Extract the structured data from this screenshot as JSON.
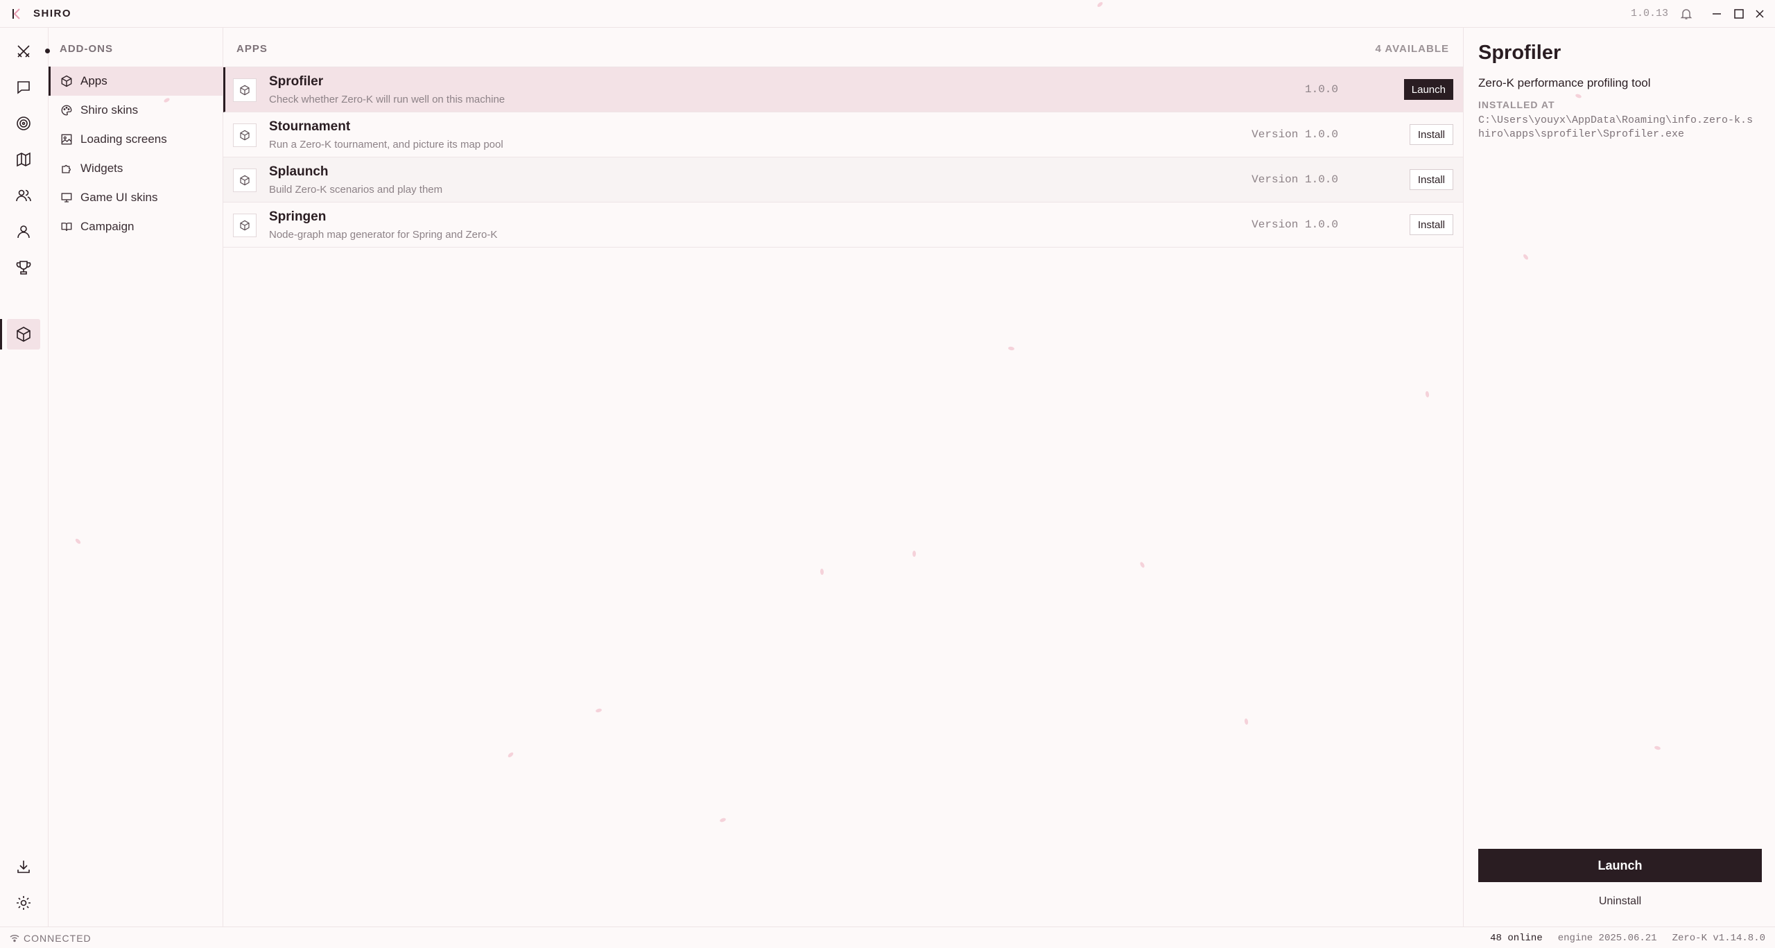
{
  "titlebar": {
    "app_name": "SHIRO",
    "version": "1.0.13"
  },
  "rail": {
    "items": [
      {
        "icon": "crossed-swords-icon"
      },
      {
        "icon": "chat-icon"
      },
      {
        "icon": "target-icon"
      },
      {
        "icon": "map-icon"
      },
      {
        "icon": "users-icon"
      },
      {
        "icon": "user-icon"
      },
      {
        "icon": "trophy-icon"
      },
      {
        "icon": "cube-icon",
        "active": true
      }
    ],
    "bottom": [
      {
        "icon": "download-icon"
      },
      {
        "icon": "gear-icon"
      }
    ]
  },
  "categories": {
    "heading": "ADD-ONS",
    "items": [
      {
        "label": "Apps",
        "icon": "cube-icon",
        "active": true
      },
      {
        "label": "Shiro skins",
        "icon": "palette-icon"
      },
      {
        "label": "Loading screens",
        "icon": "image-icon"
      },
      {
        "label": "Widgets",
        "icon": "puzzle-icon"
      },
      {
        "label": "Game UI skins",
        "icon": "monitor-icon"
      },
      {
        "label": "Campaign",
        "icon": "book-icon"
      }
    ]
  },
  "main": {
    "heading": "APPS",
    "count": "4 AVAILABLE",
    "apps": [
      {
        "title": "Sprofiler",
        "desc": "Check whether Zero-K will run well on this machine",
        "version": "1.0.0",
        "action": "Launch"
      },
      {
        "title": "Stournament",
        "desc": "Run a Zero-K tournament, and picture its map pool",
        "version": "Version 1.0.0",
        "action": "Install"
      },
      {
        "title": "Splaunch",
        "desc": "Build Zero-K scenarios and play them",
        "version": "Version 1.0.0",
        "action": "Install"
      },
      {
        "title": "Springen",
        "desc": "Node-graph map generator for Spring and Zero-K",
        "version": "Version 1.0.0",
        "action": "Install"
      }
    ]
  },
  "detail": {
    "title": "Sprofiler",
    "subtitle": "Zero-K performance profiling tool",
    "installed_label": "INSTALLED AT",
    "installed_path": "C:\\Users\\youyx\\AppData\\Roaming\\info.zero-k.shiro\\apps\\sprofiler\\Sprofiler.exe",
    "launch_label": "Launch",
    "uninstall_label": "Uninstall"
  },
  "status": {
    "connection": "CONNECTED",
    "online": "48 online",
    "engine": "engine 2025.06.21",
    "game": "Zero-K v1.14.8.0"
  },
  "colors": {
    "accent": "#2a1d22",
    "selected_bg": "#f3e2e6",
    "background": "#fdf9f9"
  }
}
